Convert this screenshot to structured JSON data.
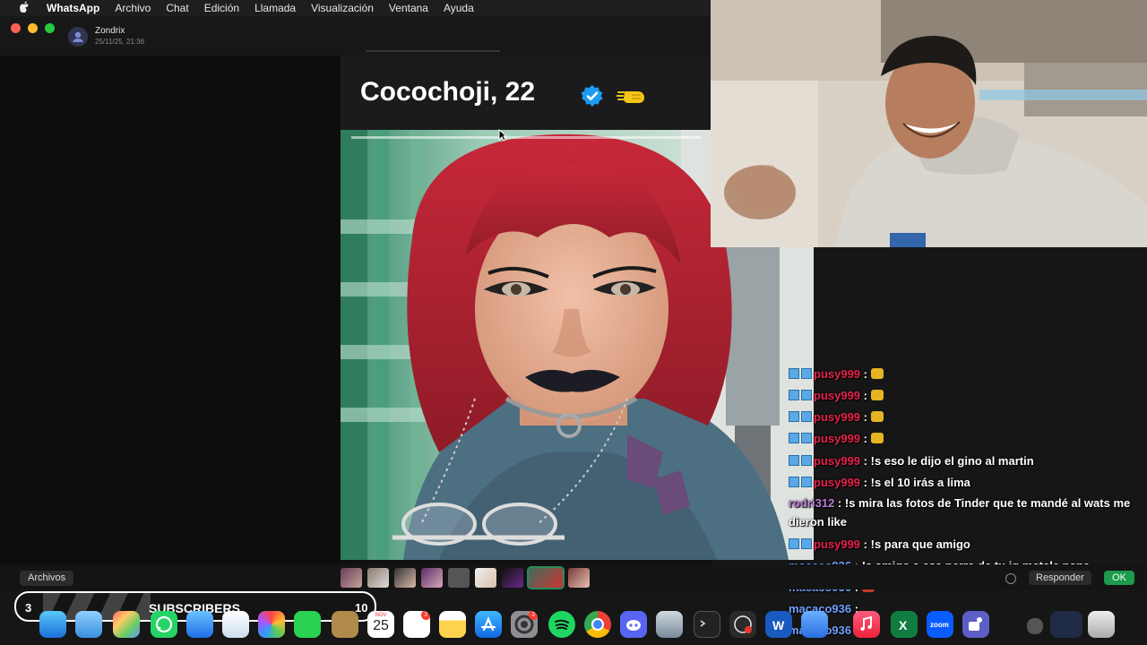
{
  "menubar": {
    "apple_icon": "apple-logo",
    "app": "WhatsApp",
    "items": [
      "Archivo",
      "Chat",
      "Edición",
      "Llamada",
      "Visualización",
      "Ventana",
      "Ayuda"
    ]
  },
  "window": {
    "contact_name": "Zondrix",
    "contact_date": "25/11/25, 21:36"
  },
  "profile": {
    "name": "Cocochoji, 22"
  },
  "strip": {
    "archivos": "Archivos",
    "responder": "Responder",
    "ok": "OK"
  },
  "chat": {
    "messages": [
      {
        "user": "pusy999",
        "text": "",
        "emote": "hands-emote"
      },
      {
        "user": "pusy999",
        "text": "",
        "emote": "hands-emote"
      },
      {
        "user": "pusy999",
        "text": "",
        "emote": "hands-emote"
      },
      {
        "user": "pusy999",
        "text": "",
        "emote": "hands-emote"
      },
      {
        "user": "pusy999",
        "text": "!s eso le dijo el gino al martin"
      },
      {
        "user": "pusy999",
        "text": "!s el 10 irás a lima"
      },
      {
        "user": "rodri312",
        "text": "!s mira las fotos de Tinder que te mandé al wats me dieron like"
      },
      {
        "user": "pusy999",
        "text": "!s para que amigo"
      },
      {
        "user": "macaco936",
        "text": "!s amigo a esa perra de tu ig metele pene"
      },
      {
        "user": "macaco936",
        "text": "",
        "emote": "face-emote"
      },
      {
        "user": "macaco936",
        "text": ""
      },
      {
        "user": "macaco936",
        "text": ""
      }
    ],
    "separator": " : "
  },
  "subscribers": {
    "current": "3",
    "label": "SUBSCRIBERS",
    "goal": "10"
  },
  "dock": {
    "calendar_month": "NOV",
    "calendar_day": "25",
    "reminders_badge": "2",
    "settings_badge": "2",
    "zoom_label": "zoom"
  },
  "colors": {
    "user_red": "#e8214b",
    "user_blue": "#6fa0ff",
    "ok_green": "#1b9b4b"
  }
}
